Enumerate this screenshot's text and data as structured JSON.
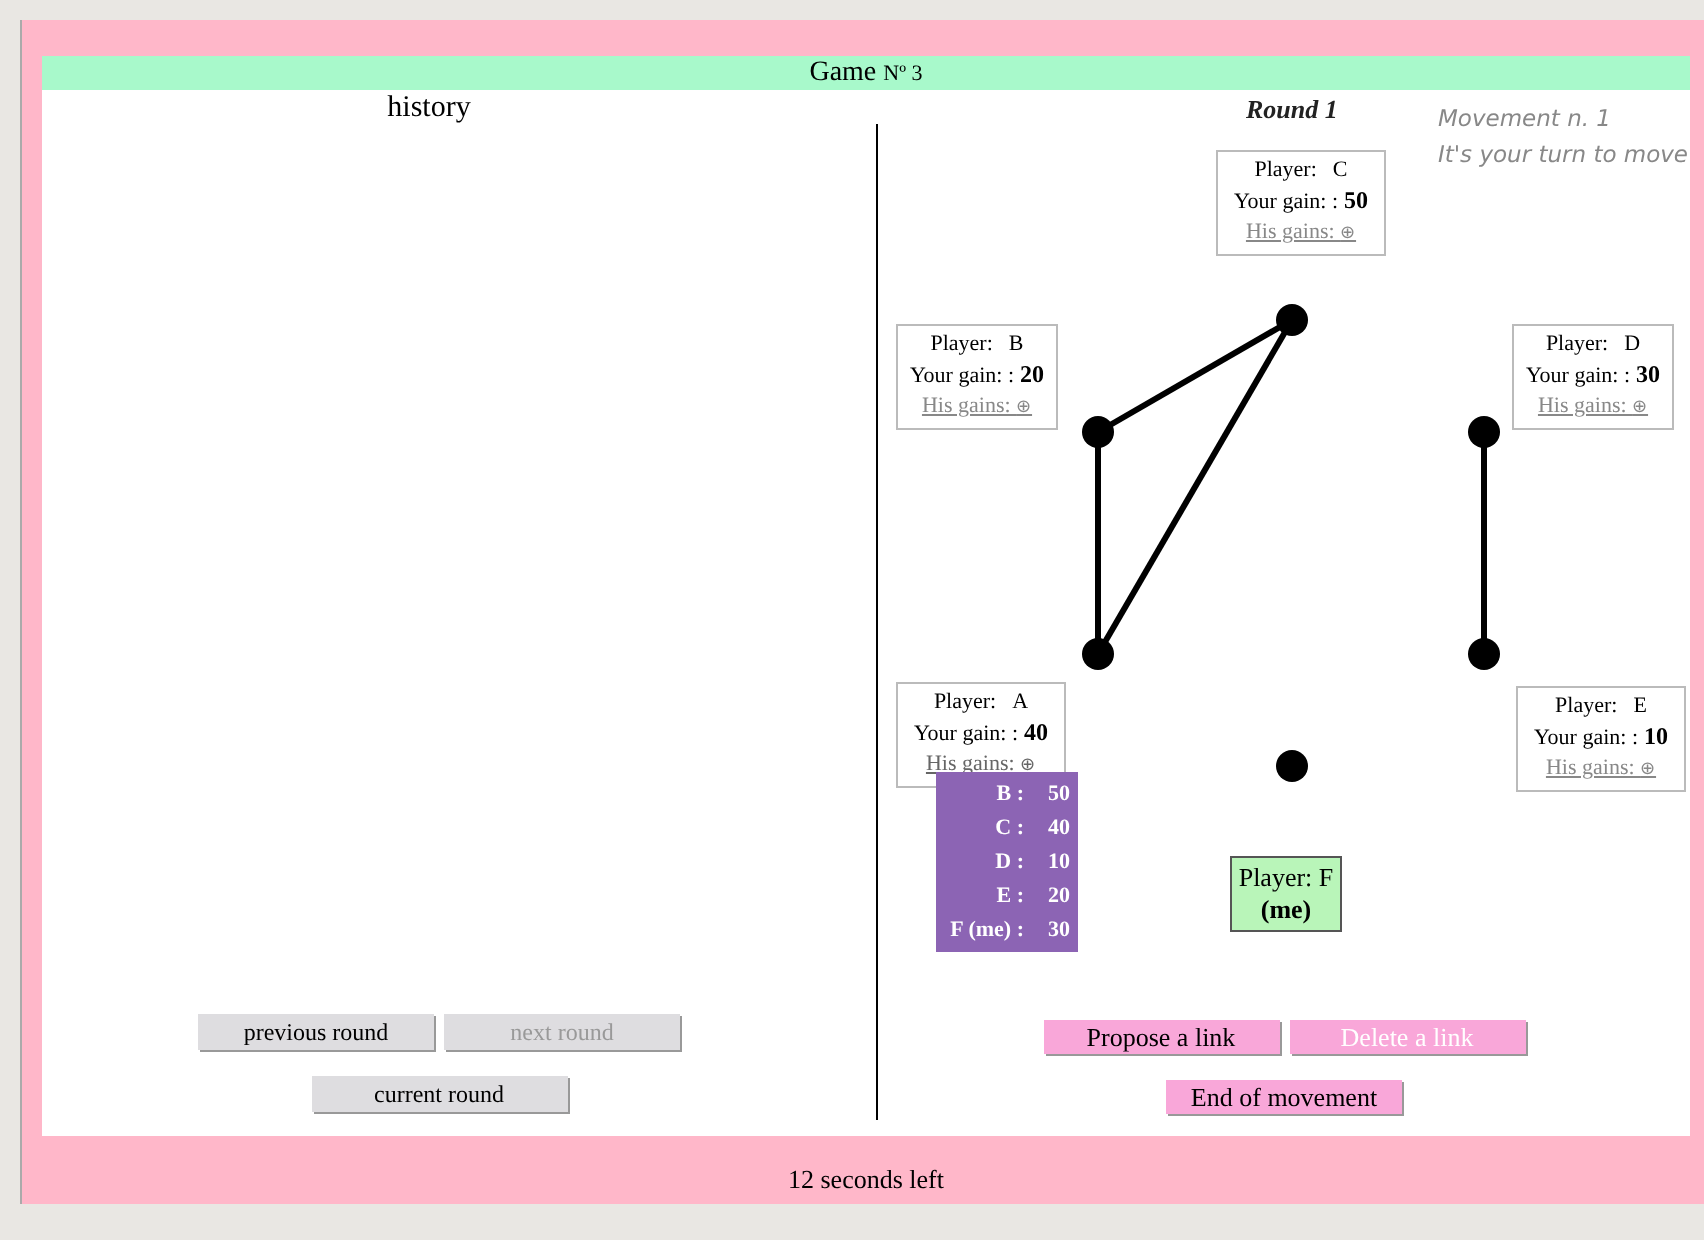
{
  "title": "Game",
  "title_suffix": "Nº 3",
  "history": {
    "heading": "history",
    "buttons": [
      {
        "label": "previous round",
        "disabled": false
      },
      {
        "label": "next round",
        "disabled": true
      },
      {
        "label": "current round",
        "disabled": false
      }
    ]
  },
  "round": "Round 1",
  "messages": [
    "Movement n. 1",
    "It's your turn to move"
  ],
  "players": [
    {
      "kind": "other",
      "player_label": "Player:",
      "name": "C",
      "gain_label": "Your gain: :",
      "gain": "50",
      "his_gains_label": "His gains:",
      "his_gains_icon": "⊕",
      "expanded": false,
      "links": [
        true,
        false,
        true,
        false,
        false
      ]
    },
    {
      "kind": "other",
      "player_label": "Player:",
      "name": "B",
      "gain_label": "Your gain: :",
      "gain": "20",
      "his_gains_label": "His gains:",
      "his_gains_icon": "⊕",
      "expanded": false,
      "links": [
        false,
        true,
        false,
        false
      ]
    },
    {
      "kind": "other",
      "player_label": "Player:",
      "name": "D",
      "gain_label": "Your gain: :",
      "gain": "30",
      "his_gains_label": "His gains:",
      "his_gains_icon": "⊕",
      "expanded": false,
      "links": [
        false,
        true,
        false
      ]
    },
    {
      "kind": "other",
      "player_label": "Player:",
      "name": "A",
      "gain_label": "Your gain: :",
      "gain": "40",
      "his_gains_label": "His gains:",
      "his_gains_icon": "⊕",
      "expanded": true,
      "his_gains": [
        {
          "name": "B :",
          "value": "50"
        },
        {
          "name": "C :",
          "value": "40"
        },
        {
          "name": "D :",
          "value": "10"
        },
        {
          "name": "E :",
          "value": "20"
        },
        {
          "name": "F (me) :",
          "value": "30"
        }
      ],
      "links": [
        false,
        false
      ]
    },
    {
      "kind": "other",
      "player_label": "Player:",
      "name": "E",
      "gain_label": "Your gain: :",
      "gain": "10",
      "his_gains_label": "His gains:",
      "his_gains_icon": "⊕",
      "expanded": false,
      "links": [
        false
      ]
    },
    {
      "kind": "me",
      "label": "Player: F",
      "sub": "(me)"
    }
  ],
  "actions": [
    {
      "label": "Propose a link",
      "disabled": false
    },
    {
      "label": "Delete a link",
      "disabled": true
    },
    {
      "label": "End of movement",
      "disabled": false
    }
  ],
  "status": "12 seconds left"
}
